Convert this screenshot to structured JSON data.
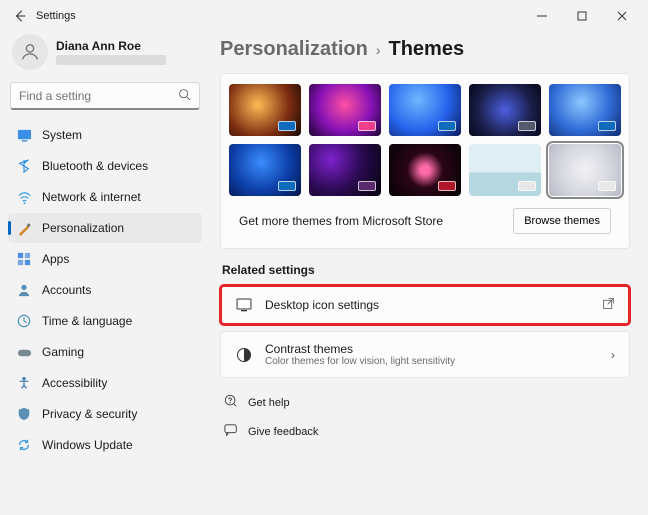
{
  "window": {
    "title": "Settings"
  },
  "user": {
    "name": "Diana Ann Roe"
  },
  "search": {
    "placeholder": "Find a setting"
  },
  "nav": {
    "system": "System",
    "bluetooth": "Bluetooth & devices",
    "network": "Network & internet",
    "personalization": "Personalization",
    "apps": "Apps",
    "accounts": "Accounts",
    "time": "Time & language",
    "gaming": "Gaming",
    "accessibility": "Accessibility",
    "privacy": "Privacy & security",
    "update": "Windows Update"
  },
  "breadcrumb": {
    "parent": "Personalization",
    "current": "Themes"
  },
  "store": {
    "text": "Get more themes from Microsoft Store",
    "button": "Browse themes"
  },
  "related": {
    "heading": "Related settings",
    "desktop_icons": "Desktop icon settings",
    "contrast_title": "Contrast themes",
    "contrast_sub": "Color themes for low vision, light sensitivity"
  },
  "help": {
    "get_help": "Get help",
    "feedback": "Give feedback"
  },
  "themes": [
    {
      "bg": "gr1",
      "swatch": "#0f6cbd"
    },
    {
      "bg": "gr2",
      "swatch": "#ef3e8c"
    },
    {
      "bg": "gr3",
      "swatch": "#0f6cbd"
    },
    {
      "bg": "gr4",
      "swatch": "#55596e"
    },
    {
      "bg": "gr5",
      "swatch": "#0f6cbd"
    },
    {
      "bg": "gr6",
      "swatch": "#0f6cbd"
    },
    {
      "bg": "gr7",
      "swatch": "#5a2a6e"
    },
    {
      "bg": "gr8",
      "swatch": "#b0172a"
    },
    {
      "bg": "gr9",
      "swatch": "#e8e8e8"
    },
    {
      "bg": "gr10",
      "swatch": "#e8e8e8",
      "selected": true
    }
  ]
}
